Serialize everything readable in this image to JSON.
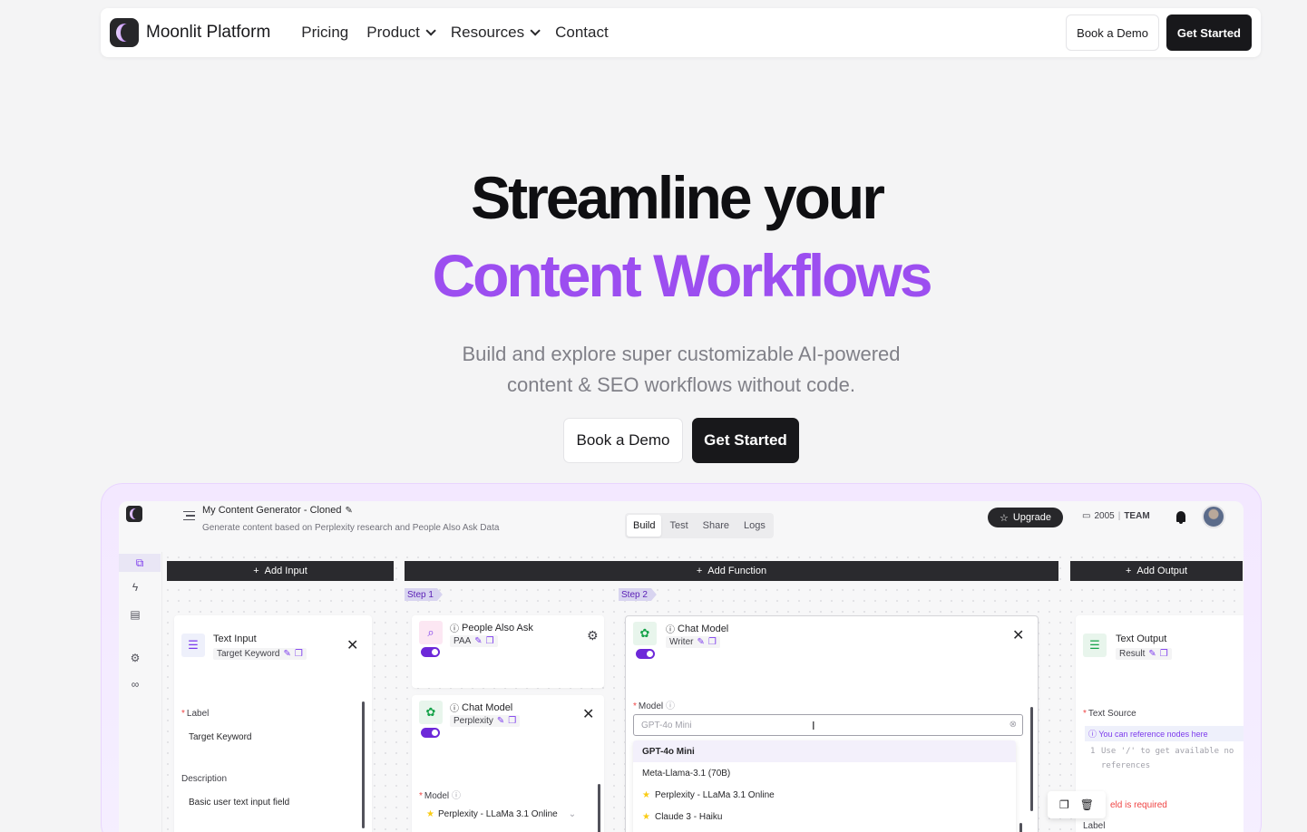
{
  "nav": {
    "brand": "Moonlit Platform",
    "links": [
      "Pricing",
      "Product",
      "Resources",
      "Contact"
    ],
    "book_demo": "Book a Demo",
    "get_started": "Get Started"
  },
  "hero": {
    "line1": "Streamline your",
    "line2": "Content Workflows",
    "sub1": "Build and explore super customizable AI-powered",
    "sub2": "content & SEO workflows without code.",
    "book_demo": "Book a Demo",
    "get_started": "Get Started"
  },
  "app": {
    "project_title": "My Content Generator - Cloned",
    "project_desc": "Generate content based on Perplexity research and People Also Ask Data",
    "tabs": [
      "Build",
      "Test",
      "Share",
      "Logs"
    ],
    "active_tab": "Build",
    "upgrade": "Upgrade",
    "credits": "2005",
    "plan": "TEAM",
    "add_input": "Add Input",
    "add_function": "Add Function",
    "add_output": "Add Output",
    "step1": "Step 1",
    "step2": "Step 2",
    "text_input": {
      "title": "Text Input",
      "name": "Target Keyword",
      "label_label": "Label",
      "label_value": "Target Keyword",
      "desc_label": "Description",
      "desc_value": "Basic user text input field"
    },
    "paa": {
      "title": "People Also Ask",
      "name": "PAA"
    },
    "chat1": {
      "title": "Chat Model",
      "name": "Perplexity",
      "model_label": "Model",
      "model_value": "Perplexity - LLaMa 3.1 Online"
    },
    "chat2": {
      "title": "Chat Model",
      "name": "Writer",
      "model_label": "Model",
      "model_placeholder": "GPT-4o Mini",
      "options": [
        "GPT-4o Mini",
        "Meta-Llama-3.1 (70B)",
        "Perplexity - LLaMa 3.1 Online",
        "Claude 3 - Haiku"
      ]
    },
    "text_output": {
      "title": "Text Output",
      "name": "Result",
      "source_label": "Text Source",
      "hint": "You can reference nodes here",
      "code_num": "1",
      "code1": "Use '/' to get available no",
      "code2": "references",
      "error": "eld is required",
      "label_cut": "Label"
    }
  },
  "colors": {
    "accent": "#9c4ef0",
    "dark": "#18181b"
  }
}
